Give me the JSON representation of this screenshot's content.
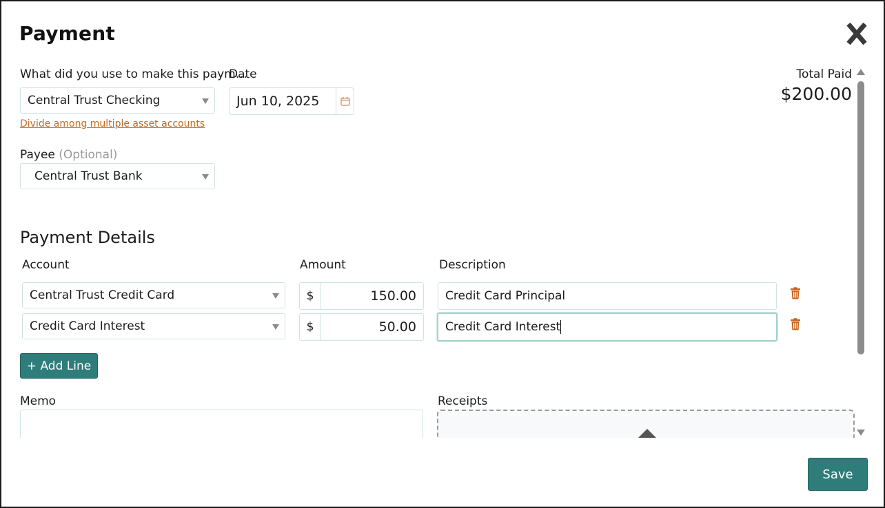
{
  "dialog": {
    "title": "Payment",
    "close_label": "X"
  },
  "source": {
    "label": "What did you use to make this paym…",
    "selected": "Central Trust Checking",
    "divide_link": "Divide among multiple asset accounts"
  },
  "date": {
    "label": "Date",
    "value": "Jun 10, 2025"
  },
  "payee": {
    "label": "Payee",
    "optional": "(Optional)",
    "selected": "Central Trust Bank"
  },
  "total": {
    "label": "Total Paid",
    "value": "$200.00"
  },
  "details": {
    "heading": "Payment Details",
    "col_account": "Account",
    "col_amount": "Amount",
    "col_description": "Description",
    "rows": [
      {
        "account": "Central Trust Credit Card",
        "currency": "$",
        "amount": "150.00",
        "description": "Credit Card Principal"
      },
      {
        "account": "Credit Card Interest",
        "currency": "$",
        "amount": "50.00",
        "description": "Credit Card Interest"
      }
    ],
    "add_line": "+ Add Line"
  },
  "memo": {
    "label": "Memo"
  },
  "receipts": {
    "label": "Receipts"
  },
  "footer": {
    "save": "Save"
  },
  "colors": {
    "accent": "#2e7d7a",
    "link": "#c86a1e",
    "trash": "#c8621c"
  },
  "icons": {
    "close": "close-icon",
    "calendar": "calendar-icon",
    "trash": "trash-icon",
    "upload": "upload-icon"
  }
}
